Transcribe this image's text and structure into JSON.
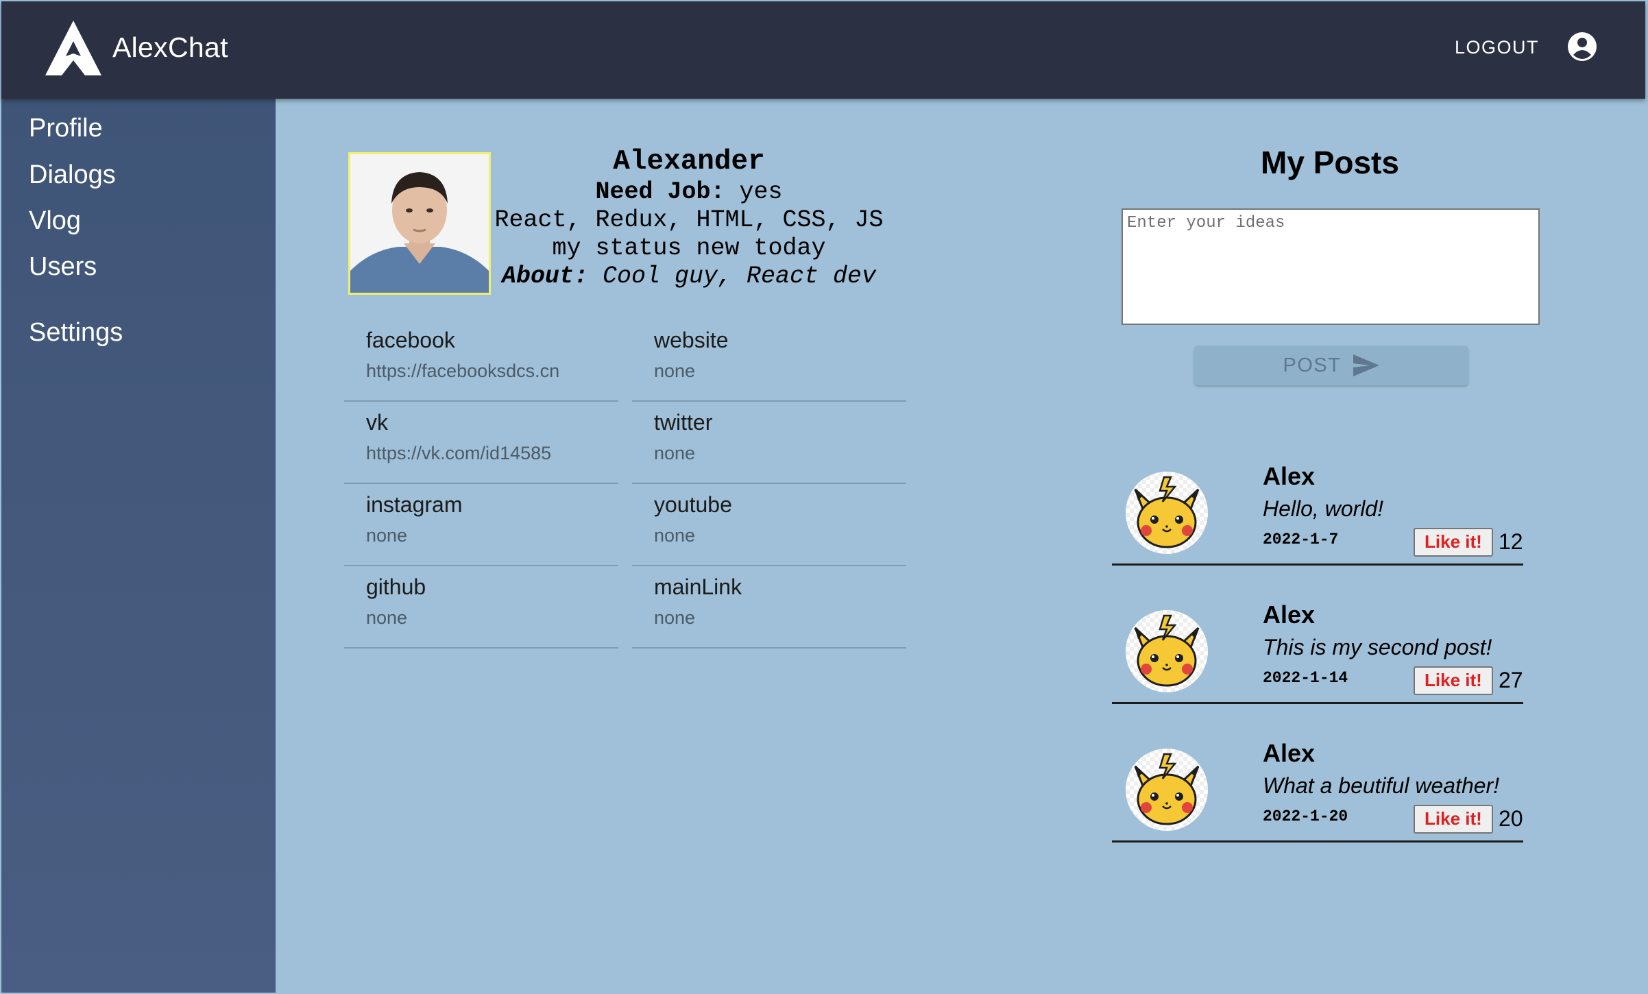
{
  "header": {
    "brand": "AlexChat",
    "logout_label": "LOGOUT",
    "logo_icon": "triangle-a-logo-icon",
    "account_icon": "account-circle-icon"
  },
  "sidebar": {
    "items": [
      {
        "label": "Profile"
      },
      {
        "label": "Dialogs"
      },
      {
        "label": "Vlog"
      },
      {
        "label": "Users"
      },
      {
        "label": "Settings"
      }
    ]
  },
  "profile": {
    "name": "Alexander",
    "need_job_label": "Need Job:",
    "need_job_value": "yes",
    "skills": "React, Redux, HTML, CSS, JS",
    "status": "my status new today",
    "about_label": "About:",
    "about_value": "Cool guy, React dev",
    "contacts": [
      {
        "key": "facebook",
        "value": "https://facebooksdcs.cn"
      },
      {
        "key": "website",
        "value": "none"
      },
      {
        "key": "vk",
        "value": "https://vk.com/id14585"
      },
      {
        "key": "twitter",
        "value": "none"
      },
      {
        "key": "instagram",
        "value": "none"
      },
      {
        "key": "youtube",
        "value": "none"
      },
      {
        "key": "github",
        "value": "none"
      },
      {
        "key": "mainLink",
        "value": "none"
      }
    ]
  },
  "posts": {
    "title": "My Posts",
    "input_placeholder": "Enter your ideas",
    "post_button_label": "POST",
    "like_label": "Like it!",
    "items": [
      {
        "author": "Alex",
        "text": "Hello, world!",
        "date": "2022-1-7",
        "likes": "12"
      },
      {
        "author": "Alex",
        "text": "This is my second post!",
        "date": "2022-1-14",
        "likes": "27"
      },
      {
        "author": "Alex",
        "text": "What a beutiful weather!",
        "date": "2022-1-20",
        "likes": "20"
      }
    ]
  },
  "colors": {
    "header_bg": "#2b3142",
    "sidebar_bg": "#435879",
    "content_bg": "#9fc0d8",
    "like_text": "#e02020",
    "avatar_border": "#f2ee6e"
  }
}
